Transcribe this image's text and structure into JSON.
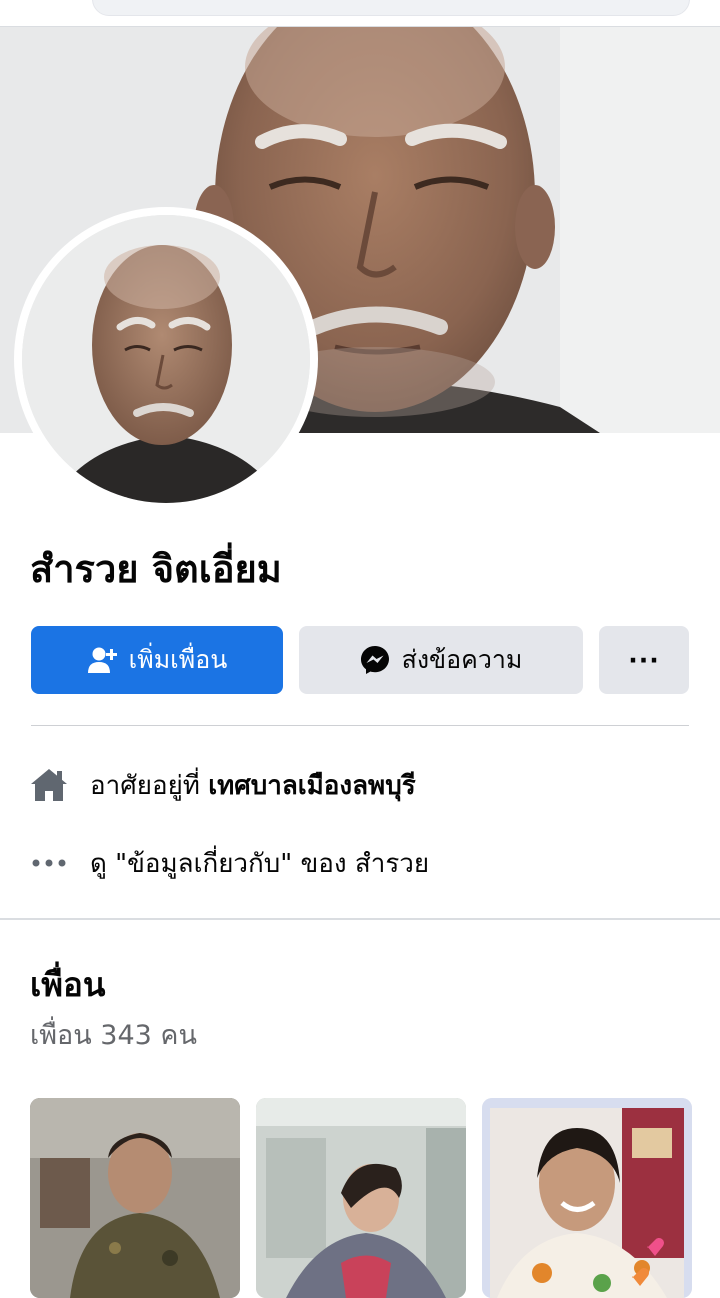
{
  "profile": {
    "name": "สำรวย จิตเอี่ยม"
  },
  "actions": {
    "add_friend_label": "เพิ่มเพื่อน",
    "message_label": "ส่งข้อความ",
    "more_label": "···"
  },
  "info": {
    "lives_prefix": "อาศัยอยู่ที่ ",
    "lives_place": "เทศบาลเมืองลพบุรี",
    "about_link": "ดู \"ข้อมูลเกี่ยวกับ\" ของ สำรวย"
  },
  "friends": {
    "title": "เพื่อน",
    "count_text": "เพื่อน 343 คน"
  },
  "colors": {
    "accent": "#1b74e4",
    "secondary_button": "#e4e6eb",
    "muted_text": "#65676b"
  },
  "icons": {
    "add_friend": "person-plus-icon",
    "message": "messenger-icon",
    "more": "more-dots-icon",
    "home": "home-icon",
    "info_more": "ellipsis-icon"
  }
}
